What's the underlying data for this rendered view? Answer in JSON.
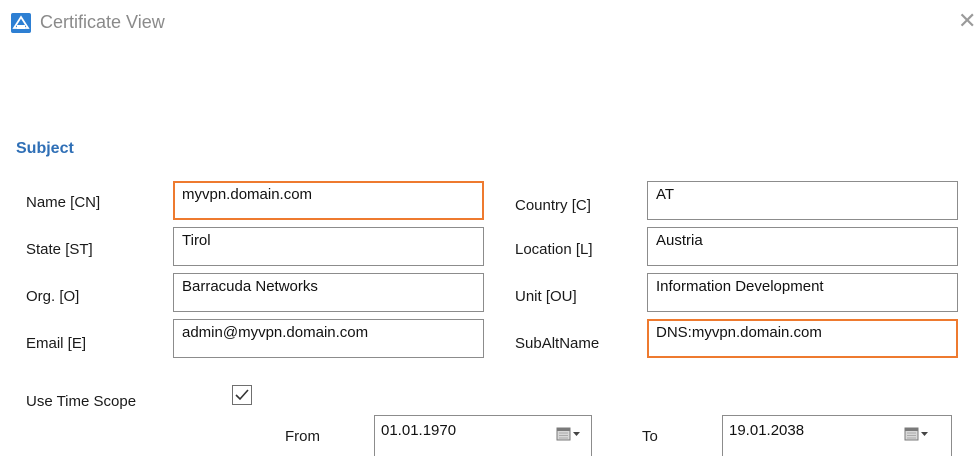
{
  "window": {
    "title": "Certificate View",
    "icon": "certificate-app-icon",
    "close_icon": "close-icon"
  },
  "subject": {
    "heading": "Subject",
    "name": {
      "label": "Name [CN]",
      "value": "myvpn.domain.com"
    },
    "state": {
      "label": "State [ST]",
      "value": "Tirol"
    },
    "org": {
      "label": "Org. [O]",
      "value": "Barracuda Networks"
    },
    "email": {
      "label": "Email [E]",
      "value": "admin@myvpn.domain.com"
    },
    "country": {
      "label": "Country [C]",
      "value": "AT"
    },
    "location": {
      "label": "Location [L]",
      "value": "Austria"
    },
    "unit": {
      "label": "Unit [OU]",
      "value": "Information Development"
    },
    "subaltname": {
      "label": "SubAltName",
      "value": "DNS:myvpn.domain.com"
    }
  },
  "time_scope": {
    "label": "Use Time Scope",
    "checked": true,
    "from_label": "From",
    "from_value": "01.01.1970",
    "to_label": "To",
    "to_value": "19.01.2038"
  },
  "colors": {
    "accent": "#2f6fb6",
    "highlight": "#ee7a2f",
    "icon_blue": "#2d7fd3"
  }
}
